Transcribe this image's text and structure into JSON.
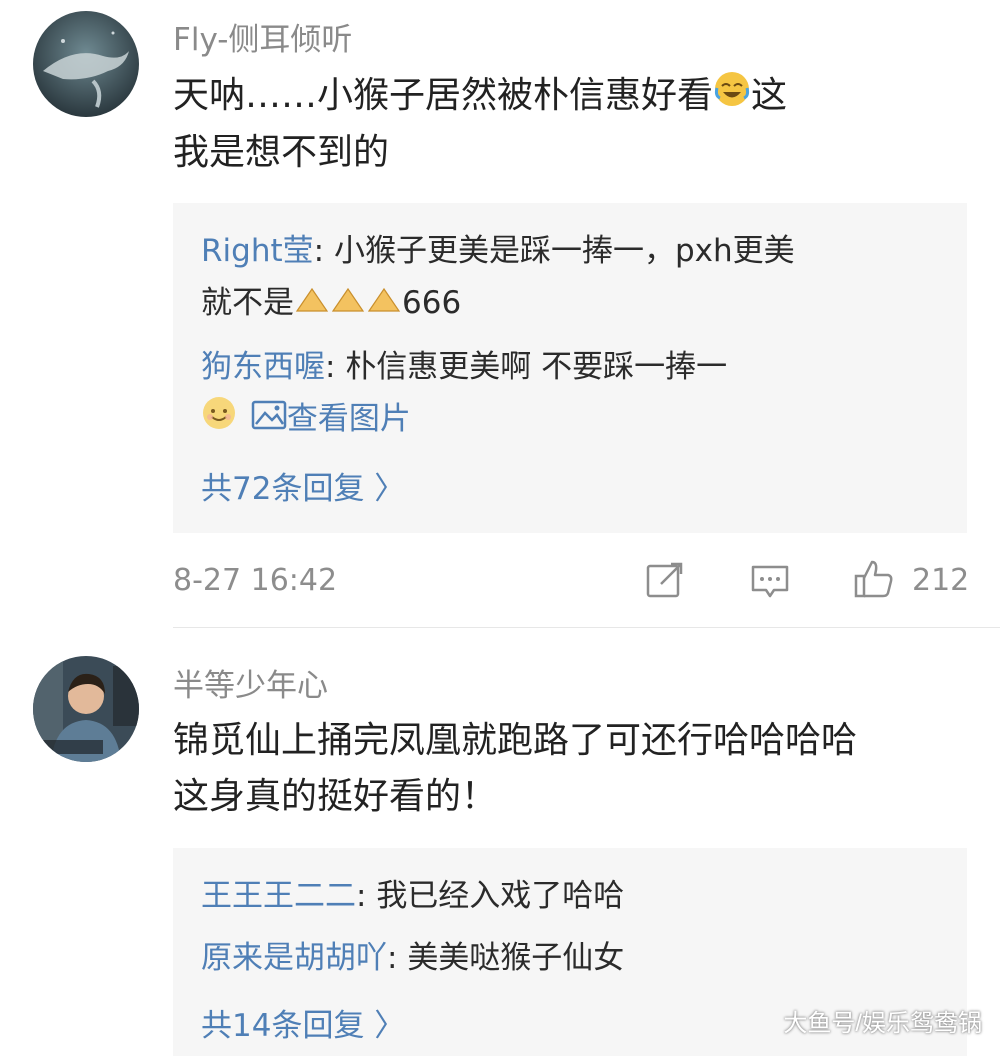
{
  "comments": [
    {
      "username": "Fly-侧耳倾听",
      "content_line1": "天呐……小猴子居然被朴信惠好看",
      "content_line1_tail": "这",
      "content_line2": "我是想不到的",
      "replies": [
        {
          "name": "Right莹",
          "sep": ": ",
          "text1": "小猴子更美是踩一捧一，pxh更美",
          "text2_pre": "就不是",
          "text2_post": "666"
        },
        {
          "name": "狗东西喔",
          "sep": ": ",
          "text1": "朴信惠更美啊  不要踩一捧一",
          "image_link": "查看图片"
        }
      ],
      "more_replies": "共72条回复 〉",
      "time": "8-27 16:42",
      "likes": "212"
    },
    {
      "username": "半等少年心",
      "content_line1": "锦觅仙上捅完凤凰就跑路了可还行哈哈哈哈",
      "content_line2": "这身真的挺好看的！",
      "replies": [
        {
          "name": "王王王二二",
          "sep": ": ",
          "text1": "我已经入戏了哈哈"
        },
        {
          "name": "原来是胡胡吖",
          "sep": ": ",
          "text1": "美美哒猴子仙女"
        }
      ],
      "more_replies": "共14条回复 〉"
    }
  ],
  "watermark": "大鱼号/娱乐鸳鸯锅",
  "icons": {
    "c1_avatar": "whale-avatar",
    "c2_avatar": "person-avatar",
    "share": "share-icon",
    "comment": "comment-icon",
    "like": "thumbs-up-icon"
  },
  "colors": {
    "link": "#4f7fb6",
    "meta": "#8d8d8d",
    "reply_bg": "#f6f6f6"
  }
}
